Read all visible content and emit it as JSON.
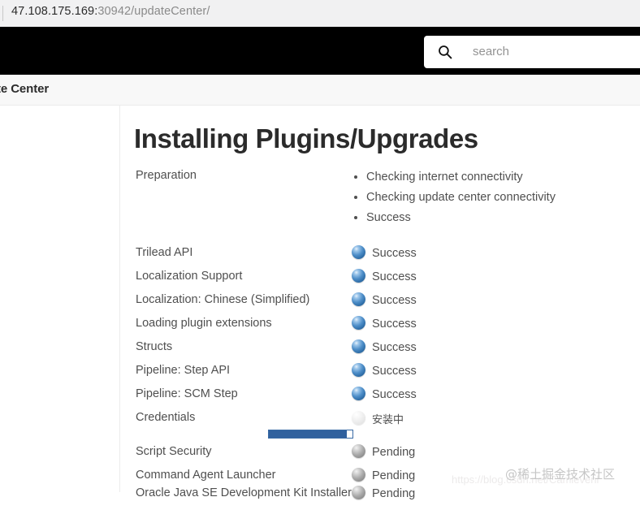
{
  "browser": {
    "url_prefix": "47.108.175.169:",
    "url_suffix": "30942/updateCenter/"
  },
  "header": {
    "search_placeholder": "search",
    "search_icon": "search-icon",
    "background": "#000000"
  },
  "breadcrumb": {
    "text": "te Center"
  },
  "main": {
    "page_title": "Installing Plugins/Upgrades",
    "preparation": {
      "label": "Preparation",
      "steps": [
        "Checking internet connectivity",
        "Checking update center connectivity",
        "Success"
      ]
    },
    "status_labels": {
      "success": "Success",
      "installing": "安装中",
      "pending": "Pending"
    },
    "progress": {
      "percent": 93
    },
    "plugins": [
      {
        "name": "Trilead API",
        "status": "Success",
        "state": "success"
      },
      {
        "name": "Localization Support",
        "status": "Success",
        "state": "success"
      },
      {
        "name": "Localization: Chinese (Simplified)",
        "status": "Success",
        "state": "success"
      },
      {
        "name": "Loading plugin extensions",
        "status": "Success",
        "state": "success"
      },
      {
        "name": "Structs",
        "status": "Success",
        "state": "success"
      },
      {
        "name": "Pipeline: Step API",
        "status": "Success",
        "state": "success"
      },
      {
        "name": "Pipeline: SCM Step",
        "status": "Success",
        "state": "success"
      },
      {
        "name": "Credentials",
        "status": "安装中",
        "state": "installing"
      },
      {
        "name": "Script Security",
        "status": "Pending",
        "state": "pending"
      },
      {
        "name": "Command Agent Launcher",
        "status": "Pending",
        "state": "pending"
      },
      {
        "name": "Oracle Java SE Development Kit Installer",
        "status": "Pending",
        "state": "pending"
      }
    ]
  },
  "watermarks": {
    "community": "@稀土掘金技术社区",
    "blog": "https://blog.csdn.net/Camievenl"
  },
  "colors": {
    "success_ball": "#4f8fc9",
    "pending_ball": "#a8a8a8",
    "progress_fill": "#30619e",
    "header_bg": "#000000",
    "text": "#4f4f4f"
  }
}
